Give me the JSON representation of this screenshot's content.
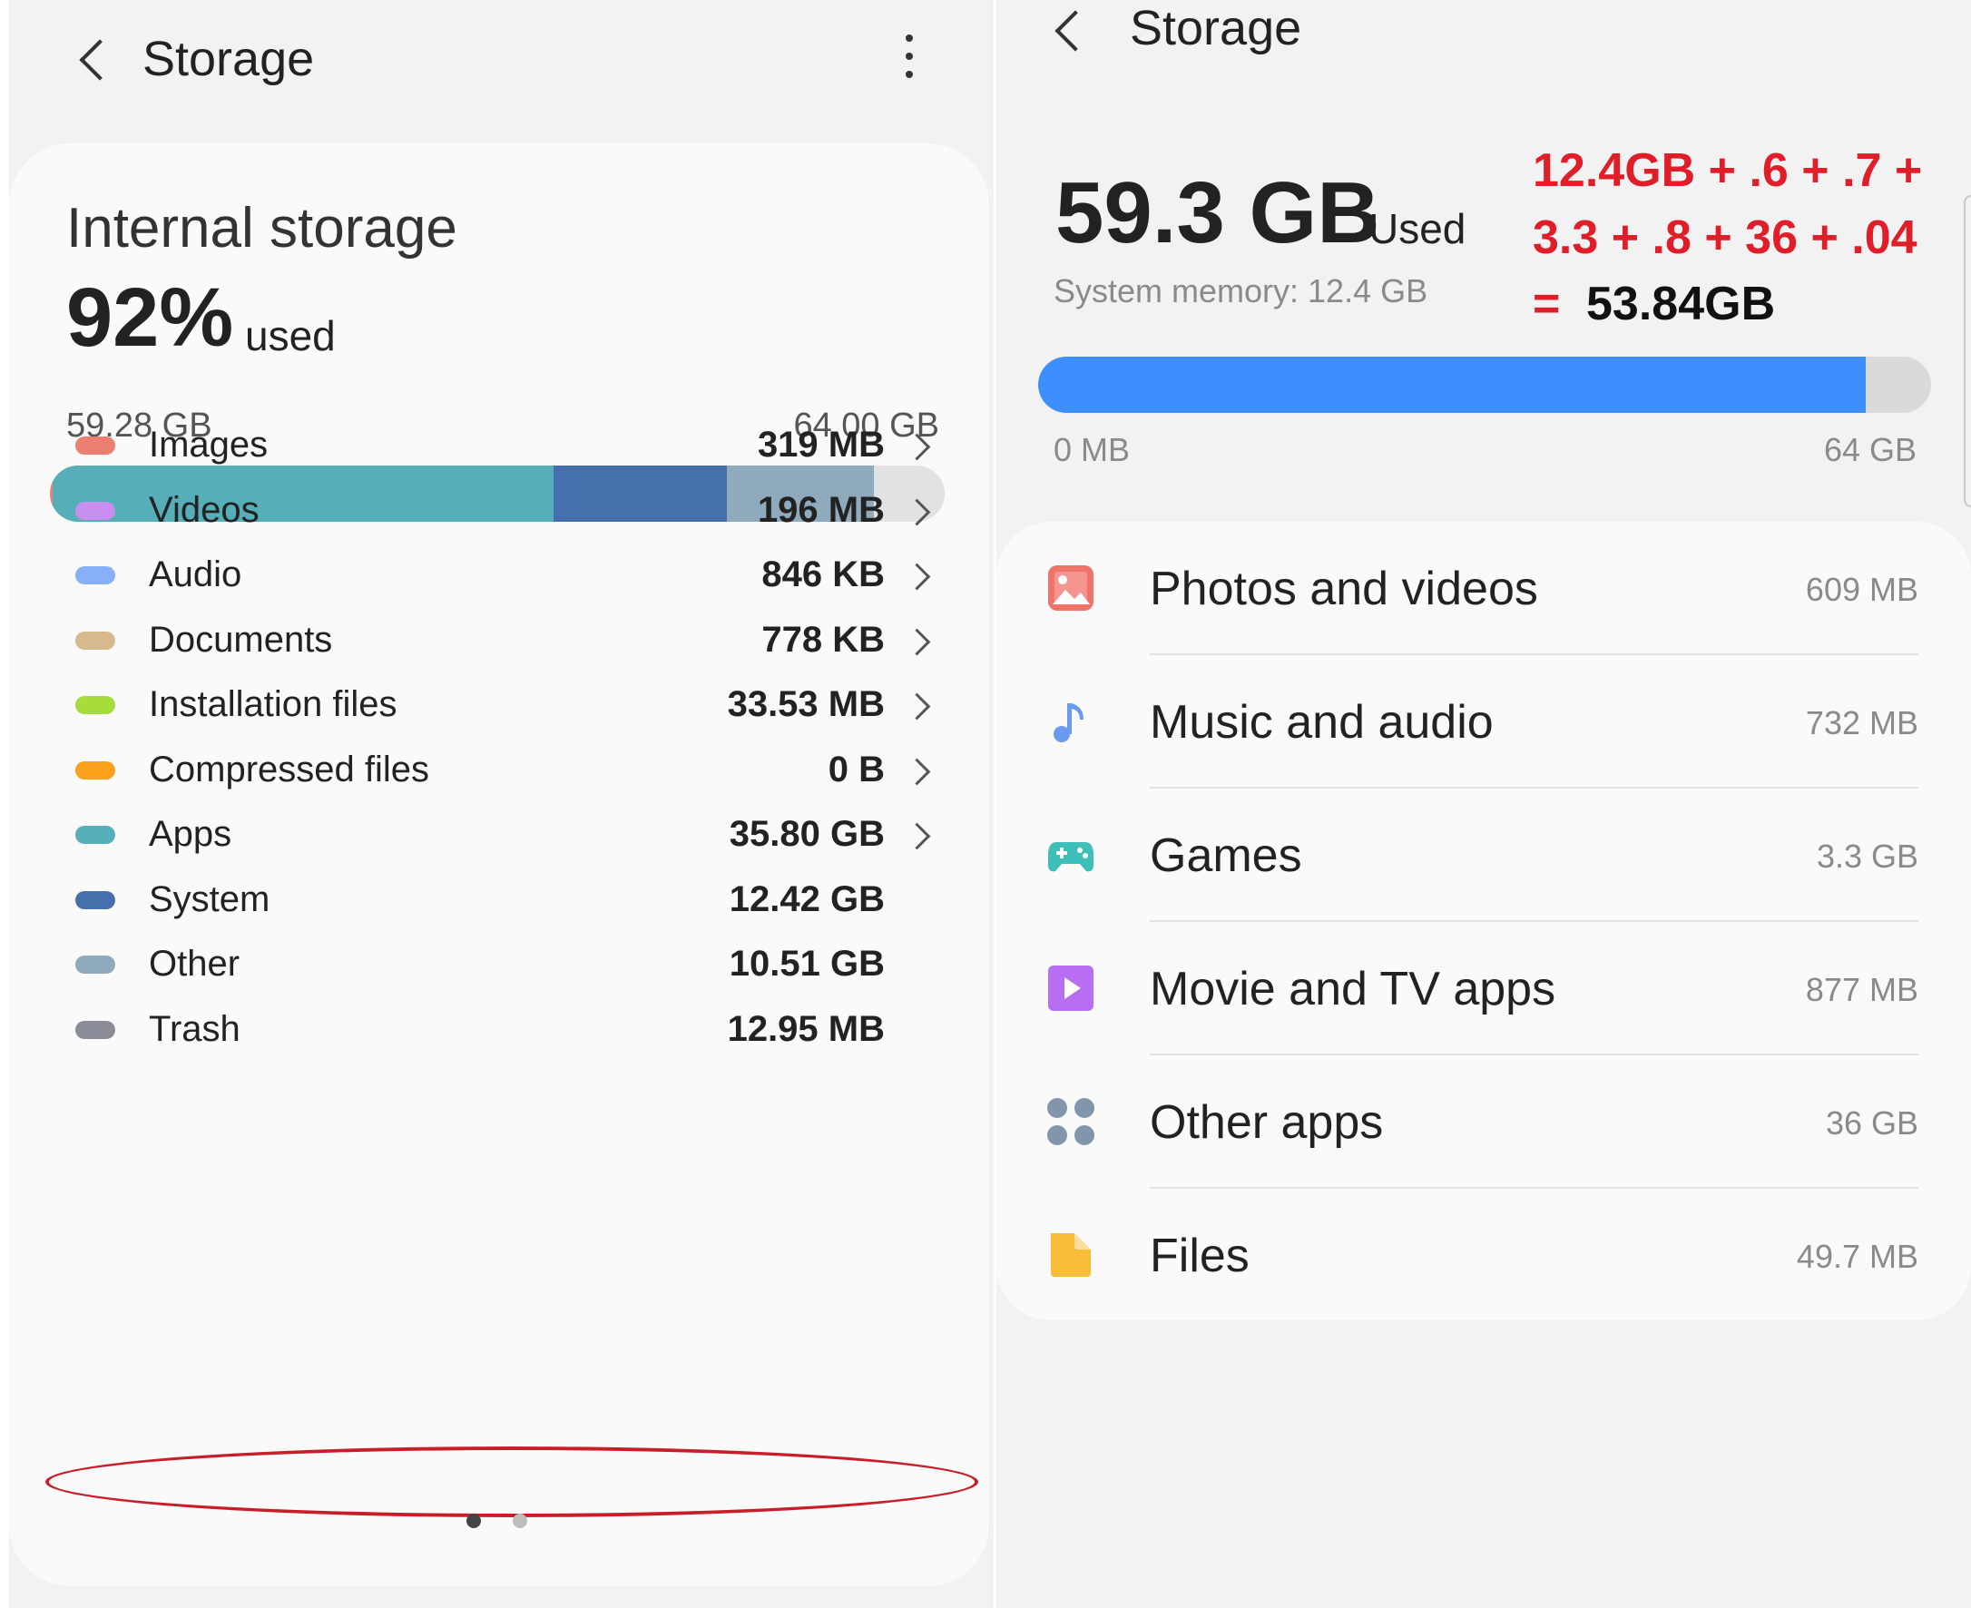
{
  "left": {
    "header": {
      "title": "Storage"
    },
    "card": {
      "title": "Internal storage",
      "percent": "92%",
      "used_word": "used",
      "used_label": "59.28 GB",
      "total_label": "64.00 GB"
    },
    "usage_bar_segments": [
      {
        "category": "Images",
        "fraction": 0.003,
        "color": "#ec7f72"
      },
      {
        "category": "Apps",
        "fraction": 0.5594,
        "color": "#56aeb8"
      },
      {
        "category": "System",
        "fraction": 0.1941,
        "color": "#4570ab"
      },
      {
        "category": "Other",
        "fraction": 0.1642,
        "color": "#8faabd"
      }
    ],
    "categories": [
      {
        "name": "Images",
        "size": "319 MB",
        "color": "#ec7f72",
        "chevron": true
      },
      {
        "name": "Videos",
        "size": "196 MB",
        "color": "#c88ef0",
        "chevron": true
      },
      {
        "name": "Audio",
        "size": "846 KB",
        "color": "#88b0f8",
        "chevron": true
      },
      {
        "name": "Documents",
        "size": "778 KB",
        "color": "#d6b98c",
        "chevron": true
      },
      {
        "name": "Installation files",
        "size": "33.53 MB",
        "color": "#a6dd3a",
        "chevron": true
      },
      {
        "name": "Compressed files",
        "size": "0 B",
        "color": "#fba11c",
        "chevron": true
      },
      {
        "name": "Apps",
        "size": "35.80 GB",
        "color": "#56aeb8",
        "chevron": true
      },
      {
        "name": "System",
        "size": "12.42 GB",
        "color": "#4570ab",
        "chevron": false
      },
      {
        "name": "Other",
        "size": "10.51 GB",
        "color": "#8faabd",
        "chevron": false
      },
      {
        "name": "Trash",
        "size": "12.95 MB",
        "color": "#8a8c98",
        "chevron": false
      }
    ],
    "page_indicator": {
      "pages": 2,
      "current": 1
    }
  },
  "right": {
    "header": {
      "title": "Storage"
    },
    "used_value": "59.3 GB",
    "used_word": "Used",
    "system_memory": "System memory: 12.4 GB",
    "annotation": {
      "line1": "12.4GB + .6 + .7 +",
      "line2": "3.3 + .8 + 36 + .04",
      "eq_sign": "=",
      "result": "53.84GB"
    },
    "bar": {
      "used_fraction": 0.9266,
      "min_label": "0 MB",
      "max_label": "64 GB",
      "fill_color": "#3c8ffc"
    },
    "apps": [
      {
        "name": "Photos and videos",
        "size": "609 MB",
        "icon": "image-icon",
        "color": "#f0736a"
      },
      {
        "name": "Music and audio",
        "size": "732 MB",
        "icon": "music-note-icon",
        "color": "#6b9bef"
      },
      {
        "name": "Games",
        "size": "3.3 GB",
        "icon": "gamepad-icon",
        "color": "#3ebfb7"
      },
      {
        "name": "Movie and TV apps",
        "size": "877 MB",
        "icon": "play-icon",
        "color": "#b86ef2"
      },
      {
        "name": "Other apps",
        "size": "36 GB",
        "icon": "apps-grid-icon",
        "color": "#8196ab"
      },
      {
        "name": "Files",
        "size": "49.7 MB",
        "icon": "file-icon",
        "color": "#f9bd39"
      }
    ]
  }
}
